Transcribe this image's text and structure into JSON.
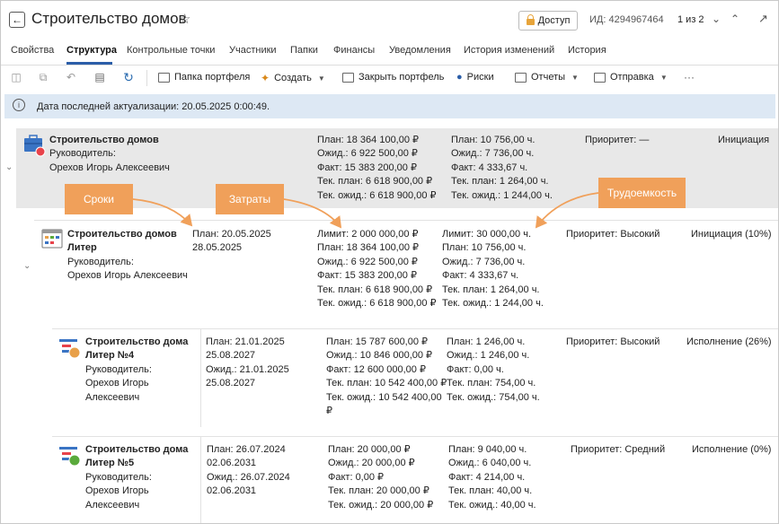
{
  "header": {
    "title": "Строительство домов",
    "access_label": "Доступ",
    "id_text": "ИД: 4294967464",
    "pager": "1 из 2"
  },
  "tabs": [
    {
      "label": "Свойства"
    },
    {
      "label": "Структура"
    },
    {
      "label": "Контрольные точки"
    },
    {
      "label": "Участники"
    },
    {
      "label": "Папки"
    },
    {
      "label": "Финансы"
    },
    {
      "label": "Уведомления"
    },
    {
      "label": "История изменений"
    },
    {
      "label": "История"
    }
  ],
  "toolbar": {
    "portfolio_folder": "Папка портфеля",
    "create": "Создать",
    "close_portfolio": "Закрыть портфель",
    "risks": "Риски",
    "reports": "Отчеты",
    "send": "Отправка",
    "more": "···"
  },
  "info": {
    "text": "Дата последней актуализации: 20.05.2025 0:00:49."
  },
  "callouts": {
    "dates": "Сроки",
    "costs": "Затраты",
    "labor": "Трудоемкость"
  },
  "rows": [
    {
      "name": "Строительство домов",
      "manager_label": "Руководитель:",
      "manager": "Орехов Игорь Алексеевич",
      "costs": [
        "План: 18 364 100,00 ₽",
        "Ожид.: 6 922 500,00 ₽",
        "Факт: 15 383 200,00 ₽",
        "Тек. план: 6 618 900,00 ₽",
        "Тек. ожид.: 6 618 900,00 ₽"
      ],
      "labor": [
        "План: 10 756,00 ч.",
        "Ожид.: 7 736,00 ч.",
        "Факт: 4 333,67 ч.",
        "Тек. план: 1 264,00 ч.",
        "Тек. ожид.: 1 244,00 ч."
      ],
      "priority": "Приоритет: —",
      "phase": "Инициация",
      "status_color": "#e8434b"
    },
    {
      "name_line1": "Строительство домов",
      "name_line2": "Литер",
      "manager_label": "Руководитель:",
      "manager": "Орехов Игорь Алексеевич",
      "dates": [
        "План: 20.05.2025",
        "28.05.2025"
      ],
      "costs": [
        "Лимит: 2 000 000,00 ₽",
        "План: 18 364 100,00 ₽",
        "Ожид.: 6 922 500,00 ₽",
        "Факт: 15 383 200,00 ₽",
        "Тек. план: 6 618 900,00 ₽",
        "Тек. ожид.: 6 618 900,00 ₽"
      ],
      "labor": [
        "Лимит: 30 000,00 ч.",
        "План: 10 756,00 ч.",
        "Ожид.: 7 736,00 ч.",
        "Факт: 4 333,67 ч.",
        "Тек. план: 1 264,00 ч.",
        "Тек. ожид.: 1 244,00 ч."
      ],
      "priority": "Приоритет: Высокий",
      "phase": "Инициация (10%)"
    },
    {
      "name_line1": "Строительство дома",
      "name_line2": "Литер №4",
      "manager_label": "Руководитель:",
      "manager_line1": "Орехов Игорь",
      "manager_line2": "Алексеевич",
      "dates": [
        "План: 21.01.2025",
        "25.08.2027",
        "Ожид.: 21.01.2025",
        "25.08.2027"
      ],
      "costs": [
        "План: 15 787 600,00 ₽",
        "Ожид.: 10 846 000,00 ₽",
        "Факт: 12 600 000,00 ₽",
        "Тек. план: 10 542 400,00 ₽",
        "Тек. ожид.: 10 542 400,00",
        "₽"
      ],
      "labor": [
        "План: 1 246,00 ч.",
        "Ожид.: 1 246,00 ч.",
        "Факт: 0,00 ч.",
        "Тек. план: 754,00 ч.",
        "Тек. ожид.: 754,00 ч."
      ],
      "priority": "Приоритет: Высокий",
      "phase": "Исполнение (26%)",
      "status_color": "#e8a04a"
    },
    {
      "name_line1": "Строительство дома",
      "name_line2": "Литер №5",
      "manager_label": "Руководитель:",
      "manager_line1": "Орехов Игорь",
      "manager_line2": "Алексеевич",
      "dates": [
        "План: 26.07.2024",
        "02.06.2031",
        "Ожид.: 26.07.2024",
        "02.06.2031"
      ],
      "costs": [
        "План: 20 000,00 ₽",
        "Ожид.: 20 000,00 ₽",
        "Факт: 0,00 ₽",
        "Тек. план: 20 000,00 ₽",
        "Тек. ожид.: 20 000,00 ₽"
      ],
      "labor": [
        "План: 9 040,00 ч.",
        "Ожид.: 6 040,00 ч.",
        "Факт: 4 214,00 ч.",
        "Тек. план: 40,00 ч.",
        "Тек. ожид.: 40,00 ч."
      ],
      "priority": "Приоритет: Средний",
      "phase": "Исполнение (0%)",
      "status_color": "#5aaa3c"
    }
  ]
}
